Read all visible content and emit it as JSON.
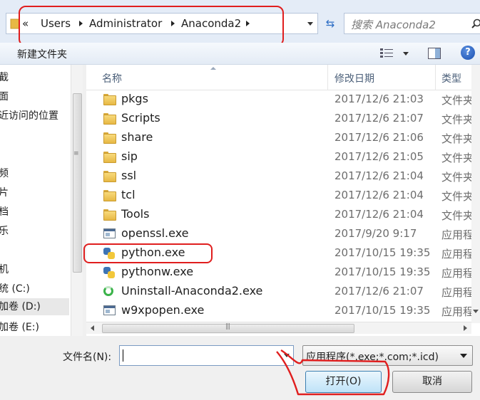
{
  "address_bar": {
    "overflow": "«",
    "crumbs": [
      "Users",
      "Administrator",
      "Anaconda2"
    ],
    "search_placeholder": "搜索 Anaconda2"
  },
  "toolbar": {
    "new_folder_label": "新建文件夹"
  },
  "nav_pane": {
    "items": [
      "截",
      "面",
      "近访问的位置",
      "频",
      "片",
      "档",
      "乐",
      "机",
      "统 (C:)",
      "加卷 (D:)",
      "加卷 (E:)"
    ],
    "selected_index": 9
  },
  "file_list": {
    "headers": {
      "name": "名称",
      "date": "修改日期",
      "type": "类型"
    },
    "rows": [
      {
        "name": "pkgs",
        "date": "2017/12/6 21:03",
        "type": "文件夹",
        "icon": "folder-icon"
      },
      {
        "name": "Scripts",
        "date": "2017/12/6 21:07",
        "type": "文件夹",
        "icon": "folder-icon"
      },
      {
        "name": "share",
        "date": "2017/12/6 21:06",
        "type": "文件夹",
        "icon": "folder-icon"
      },
      {
        "name": "sip",
        "date": "2017/12/6 21:05",
        "type": "文件夹",
        "icon": "folder-icon"
      },
      {
        "name": "ssl",
        "date": "2017/12/6 21:04",
        "type": "文件夹",
        "icon": "folder-icon"
      },
      {
        "name": "tcl",
        "date": "2017/12/6 21:04",
        "type": "文件夹",
        "icon": "folder-icon"
      },
      {
        "name": "Tools",
        "date": "2017/12/6 21:04",
        "type": "文件夹",
        "icon": "folder-icon"
      },
      {
        "name": "openssl.exe",
        "date": "2017/9/20 9:17",
        "type": "应用程序",
        "icon": "exe-icon"
      },
      {
        "name": "python.exe",
        "date": "2017/10/15 19:35",
        "type": "应用程序",
        "icon": "python-icon"
      },
      {
        "name": "pythonw.exe",
        "date": "2017/10/15 19:35",
        "type": "应用程序",
        "icon": "python-icon"
      },
      {
        "name": "Uninstall-Anaconda2.exe",
        "date": "2017/12/6 21:07",
        "type": "应用程序",
        "icon": "uninstall-icon"
      },
      {
        "name": "w9xpopen.exe",
        "date": "2017/10/15 19:35",
        "type": "应用程序",
        "icon": "exe-icon"
      }
    ]
  },
  "bottom": {
    "filename_label": "文件名(N):",
    "filename_value": "",
    "filetype_value": "应用程序(*.exe;*.com;*.icd)",
    "open_label": "打开(O)",
    "cancel_label": "取消"
  },
  "colors": {
    "annotation": "#e01e1e",
    "header_text": "#4c607a",
    "open_button_border": "#3c7fb1"
  }
}
